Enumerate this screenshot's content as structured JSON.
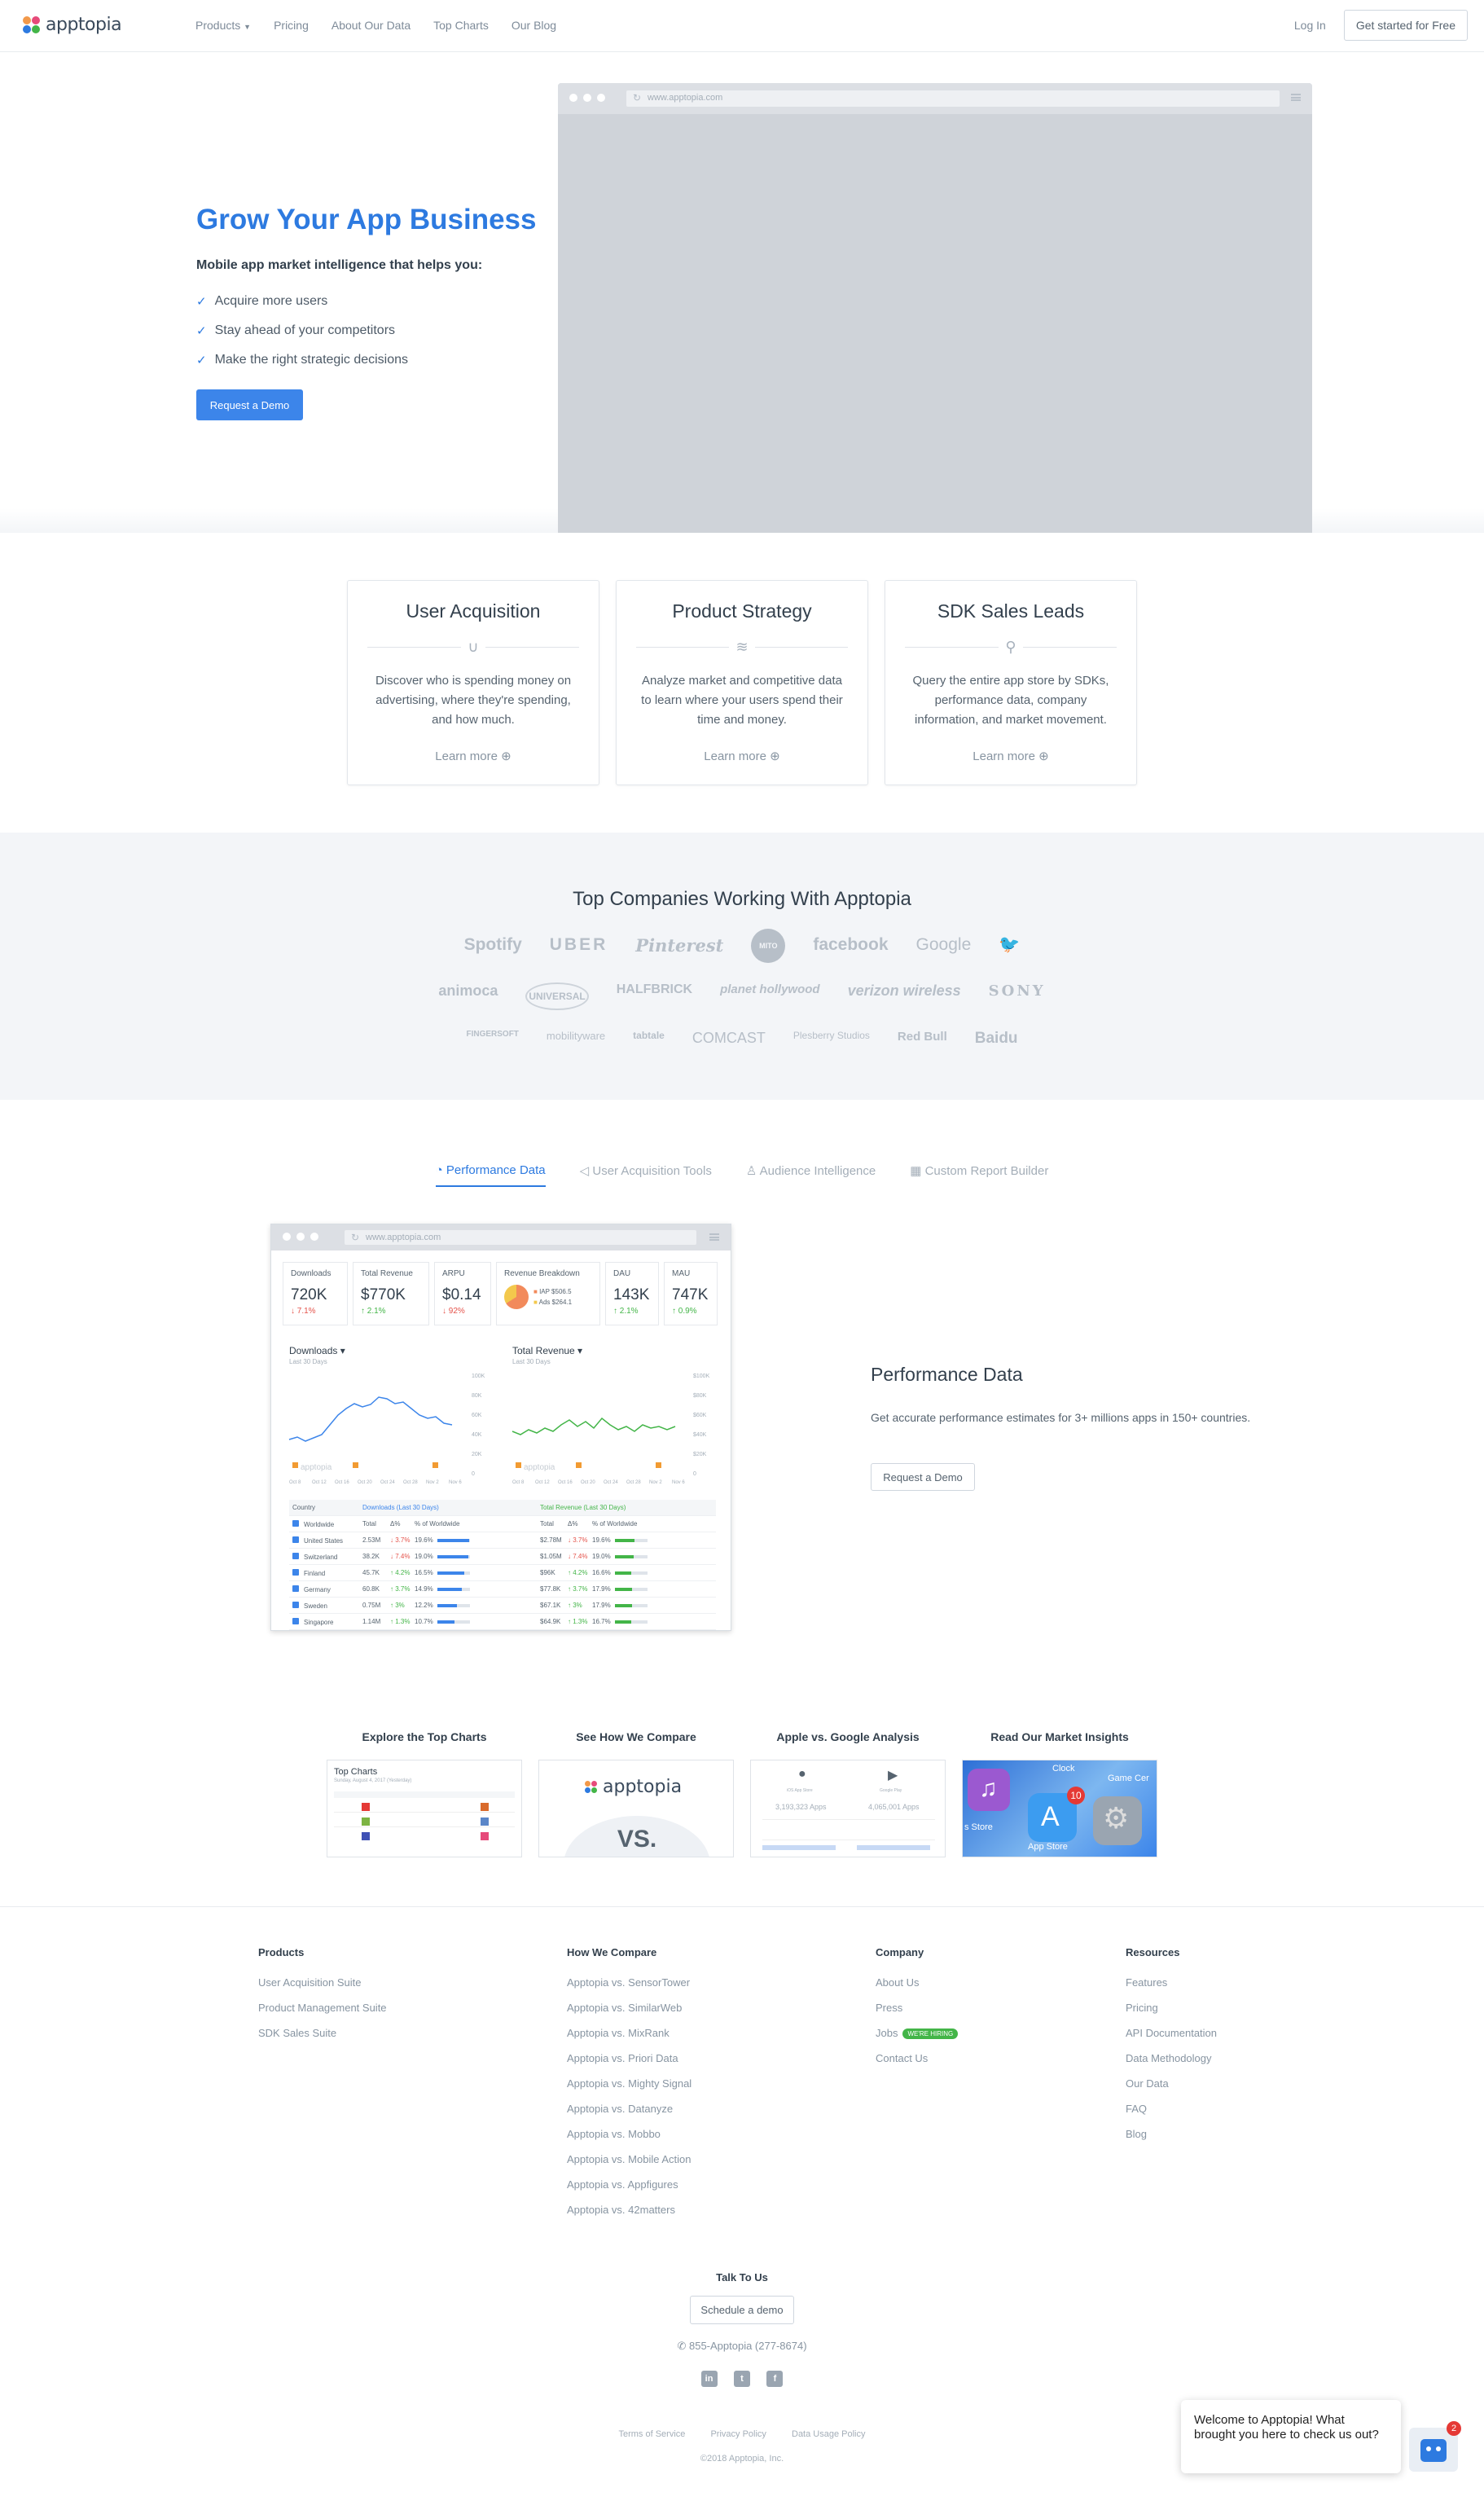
{
  "header": {
    "brand": "apptopia",
    "nav": [
      "Products",
      "Pricing",
      "About Our Data",
      "Top Charts",
      "Our Blog"
    ],
    "login": "Log In",
    "cta": "Get started for Free"
  },
  "hero": {
    "title": "Grow Your App Business",
    "subtitle": "Mobile app market intelligence that helps you:",
    "bullets": [
      "Acquire more users",
      "Stay ahead of your competitors",
      "Make the right strategic decisions"
    ],
    "button": "Request a Demo",
    "browser_url": "www.apptopia.com"
  },
  "cards": [
    {
      "title": "User Acquisition",
      "text": "Discover who is spending money on advertising, where they're spending, and how much.",
      "link": "Learn more",
      "icon": "magnet-icon"
    },
    {
      "title": "Product Strategy",
      "text": "Analyze market and competitive data to learn where your users spend their time and money.",
      "link": "Learn more",
      "icon": "layers-icon"
    },
    {
      "title": "SDK Sales Leads",
      "text": "Query the entire app store by SDKs, performance data, company information, and market movement.",
      "link": "Learn more",
      "icon": "search-icon"
    }
  ],
  "companies": {
    "title": "Top Companies Working With Apptopia",
    "row1": [
      "Spotify",
      "UBER",
      "Pinterest",
      "MITO",
      "facebook",
      "Google",
      "twitter-bird"
    ],
    "row2": [
      "animoca",
      "UNIVERSAL",
      "HALFBRICK",
      "planet hollywood",
      "verizon wireless",
      "SONY"
    ],
    "row3": [
      "FINGERSOFT",
      "mobilityware",
      "tabtale",
      "COMCAST",
      "Plesberry Studios",
      "Red Bull",
      "Baidu"
    ]
  },
  "tabs": [
    {
      "label": "Performance Data",
      "icon": "performance-icon",
      "active": true
    },
    {
      "label": "User Acquisition Tools",
      "icon": "megaphone-icon",
      "active": false
    },
    {
      "label": "Audience Intelligence",
      "icon": "user-icon",
      "active": false
    },
    {
      "label": "Custom Report Builder",
      "icon": "report-icon",
      "active": false
    }
  ],
  "dashboard": {
    "url": "www.apptopia.com",
    "kpis": [
      {
        "label": "Downloads",
        "value": "720K",
        "delta": "↓ 7.1%",
        "dir": "down"
      },
      {
        "label": "Total Revenue",
        "value": "$770K",
        "delta": "↑ 2.1%",
        "dir": "up"
      },
      {
        "label": "ARPU",
        "value": "$0.14",
        "delta": "↓ 92%",
        "dir": "down"
      },
      {
        "label": "Revenue Breakdown",
        "iap": "IAP  $506.5",
        "ads": "Ads  $264.1"
      },
      {
        "label": "DAU",
        "value": "143K",
        "delta": "↑ 2.1%",
        "dir": "up"
      },
      {
        "label": "MAU",
        "value": "747K",
        "delta": "↑ 0.9%",
        "dir": "up"
      }
    ],
    "chart1": {
      "title": "Downloads",
      "sub": "Last 30 Days",
      "yticks": [
        "100K",
        "80K",
        "60K",
        "40K",
        "20K",
        "0"
      ],
      "xticks": [
        "Oct 8",
        "Oct 12",
        "Oct 16",
        "Oct 20",
        "Oct 24",
        "Oct 28",
        "Nov 2",
        "Nov 6"
      ],
      "watermark": "apptopia"
    },
    "chart2": {
      "title": "Total Revenue",
      "sub": "Last 30 Days",
      "yticks": [
        "$100K",
        "$80K",
        "$60K",
        "$40K",
        "$20K",
        "0"
      ],
      "xticks": [
        "Oct 8",
        "Oct 12",
        "Oct 16",
        "Oct 20",
        "Oct 24",
        "Oct 28",
        "Nov 2",
        "Nov 6"
      ],
      "watermark": "apptopia"
    },
    "table": {
      "headers": [
        "Country",
        "Downloads (Last 30 Days)",
        "Total Revenue (Last 30 Days)"
      ],
      "subheaders": [
        "Total",
        "Δ%",
        "% of Worldwide",
        "Total",
        "Δ%",
        "% of Worldwide"
      ],
      "rows": [
        {
          "country": "Worldwide",
          "dl": "",
          "dld": "",
          "dlp": "",
          "rv": "",
          "rvd": "",
          "rvp": ""
        },
        {
          "country": "United States",
          "dl": "2.53M",
          "dld": "↓ 3.7%",
          "dlp": "19.6%",
          "rv": "$2.78M",
          "rvd": "↓ 3.7%",
          "rvp": "19.6%"
        },
        {
          "country": "Switzerland",
          "dl": "38.2K",
          "dld": "↓ 7.4%",
          "dlp": "19.0%",
          "rv": "$1.05M",
          "rvd": "↓ 7.4%",
          "rvp": "19.0%"
        },
        {
          "country": "Finland",
          "dl": "45.7K",
          "dld": "↑ 4.2%",
          "dlp": "16.5%",
          "rv": "$96K",
          "rvd": "↑ 4.2%",
          "rvp": "16.6%"
        },
        {
          "country": "Germany",
          "dl": "60.8K",
          "dld": "↑ 3.7%",
          "dlp": "14.9%",
          "rv": "$77.8K",
          "rvd": "↑ 3.7%",
          "rvp": "17.9%"
        },
        {
          "country": "Sweden",
          "dl": "0.75M",
          "dld": "↑ 3%",
          "dlp": "12.2%",
          "rv": "$67.1K",
          "rvd": "↑ 3%",
          "rvp": "17.9%"
        },
        {
          "country": "Singapore",
          "dl": "1.14M",
          "dld": "↑ 1.3%",
          "dlp": "10.7%",
          "rv": "$64.9K",
          "rvd": "↑ 1.3%",
          "rvp": "16.7%"
        }
      ]
    }
  },
  "performance": {
    "title": "Performance Data",
    "text": "Get accurate performance estimates for 3+ millions apps in 150+ countries.",
    "button": "Request a Demo"
  },
  "thumbs": [
    {
      "title": "Explore the Top Charts",
      "inner": "Top Charts",
      "sub": "Sunday, August 4, 2017 (Yesterday)"
    },
    {
      "title": "See How We Compare",
      "inner": "apptopia",
      "vs": "VS."
    },
    {
      "title": "Apple vs. Google Analysis",
      "a": "iOS App Store",
      "b": "Google Play",
      "an": "3,193,323 Apps",
      "bn": "4,065,001 Apps"
    },
    {
      "title": "Read Our Market Insights",
      "badge": "10",
      "t1": "Clock",
      "t2": "Game Cer",
      "t3": "s Store",
      "t4": "App Store"
    }
  ],
  "footer": {
    "cols": [
      {
        "title": "Products",
        "items": [
          "User Acquisition Suite",
          "Product Management Suite",
          "SDK Sales Suite"
        ]
      },
      {
        "title": "How We Compare",
        "items": [
          "Apptopia vs. SensorTower",
          "Apptopia vs. SimilarWeb",
          "Apptopia vs. MixRank",
          "Apptopia vs. Priori Data",
          "Apptopia vs. Mighty Signal",
          "Apptopia vs. Datanyze",
          "Apptopia vs. Mobbo",
          "Apptopia vs. Mobile Action",
          "Apptopia vs. Appfigures",
          "Apptopia vs. 42matters"
        ]
      },
      {
        "title": "Company",
        "items": [
          "About Us",
          "Press",
          "Jobs",
          "Contact Us"
        ],
        "badge": "WE'RE HIRING"
      },
      {
        "title": "Resources",
        "items": [
          "Features",
          "Pricing",
          "API Documentation",
          "Data Methodology",
          "Our Data",
          "FAQ",
          "Blog"
        ]
      }
    ],
    "talk": "Talk To Us",
    "schedule": "Schedule a demo",
    "phone": "855-Apptopia (277-8674)",
    "links": [
      "Terms of Service",
      "Privacy Policy",
      "Data Usage Policy"
    ],
    "copyright": "©2018 Apptopia, Inc."
  },
  "chat": {
    "text": "Welcome to Apptopia! What brought you here to check us out?",
    "badge": "2"
  },
  "colors": {
    "accent": "#2d7ae0",
    "button": "#3c85ea",
    "up": "#43b548",
    "down": "#e5534b"
  }
}
